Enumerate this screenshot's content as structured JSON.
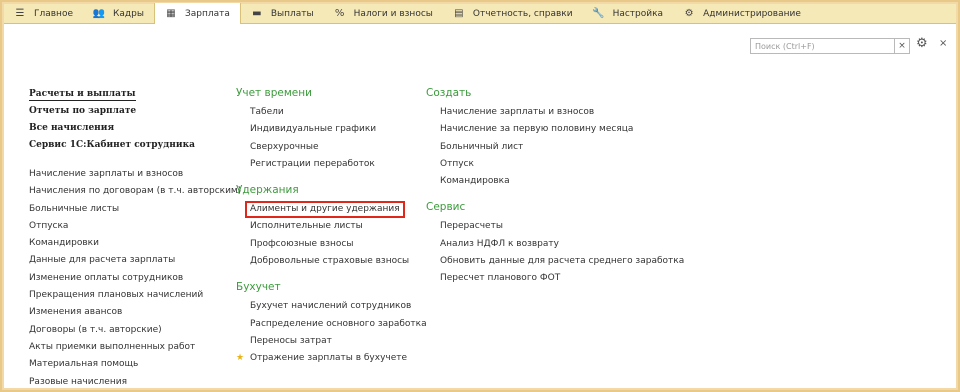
{
  "topbar": {
    "tabs": [
      {
        "label": "Главное",
        "icon": "menu-icon",
        "glyph": "☰",
        "active": false
      },
      {
        "label": "Кадры",
        "icon": "people-icon",
        "glyph": "👥",
        "active": false
      },
      {
        "label": "Зарплата",
        "icon": "calculator-icon",
        "glyph": "▦",
        "active": true
      },
      {
        "label": "Выплаты",
        "icon": "payment-icon",
        "glyph": "▬",
        "active": false
      },
      {
        "label": "Налоги и взносы",
        "icon": "percent-icon",
        "glyph": "%",
        "active": false
      },
      {
        "label": "Отчетность, справки",
        "icon": "report-icon",
        "glyph": "▤",
        "active": false
      },
      {
        "label": "Настройка",
        "icon": "wrench-icon",
        "glyph": "🔧",
        "active": false
      },
      {
        "label": "Администрирование",
        "icon": "gear-icon",
        "glyph": "⚙",
        "active": false
      }
    ]
  },
  "search": {
    "placeholder": "Поиск (Ctrl+F)",
    "clear": "×"
  },
  "toolbar": {
    "settings_glyph": "⚙",
    "close_glyph": "×"
  },
  "left": {
    "bold_items": [
      "Расчеты и выплаты",
      "Отчеты по зарплате",
      "Все начисления",
      "Сервис 1С:Кабинет сотрудника"
    ],
    "items": [
      "Начисление зарплаты и взносов",
      "Начисления по договорам (в т.ч. авторским)",
      "Больничные листы",
      "Отпуска",
      "Командировки",
      "Данные для расчета зарплаты",
      "Изменение оплаты сотрудников",
      "Прекращения плановых начислений",
      "Изменения авансов",
      "Договоры (в т.ч. авторские)",
      "Акты приемки выполненных работ",
      "Материальная помощь",
      "Разовые начисления"
    ]
  },
  "middle": {
    "sections": [
      {
        "title": "Учет времени",
        "items": [
          "Табели",
          "Индивидуальные графики",
          "Сверхурочные",
          "Регистрации переработок"
        ]
      },
      {
        "title": "Удержания",
        "items": [
          "Алименты и другие удержания",
          "Исполнительные листы",
          "Профсоюзные взносы",
          "Добровольные страховые взносы"
        ]
      },
      {
        "title": "Бухучет",
        "items": [
          "Бухучет начислений сотрудников",
          "Распределение основного заработка",
          "Переносы затрат",
          "Отражение зарплаты в бухучете"
        ]
      }
    ],
    "star_glyph": "★"
  },
  "right": {
    "sections": [
      {
        "title": "Создать",
        "items": [
          "Начисление зарплаты и взносов",
          "Начисление за первую половину месяца",
          "Больничный лист",
          "Отпуск",
          "Командировка"
        ]
      },
      {
        "title": "Сервис",
        "items": [
          "Перерасчеты",
          "Анализ НДФЛ к возврату",
          "Обновить данные для расчета среднего заработка",
          "Пересчет планового ФОТ"
        ]
      }
    ]
  },
  "colors": {
    "section_title": "#3c9a3c",
    "highlight_border": "#e0271b",
    "topbar_bg": "#f6e9b8",
    "star": "#e7b31a"
  }
}
